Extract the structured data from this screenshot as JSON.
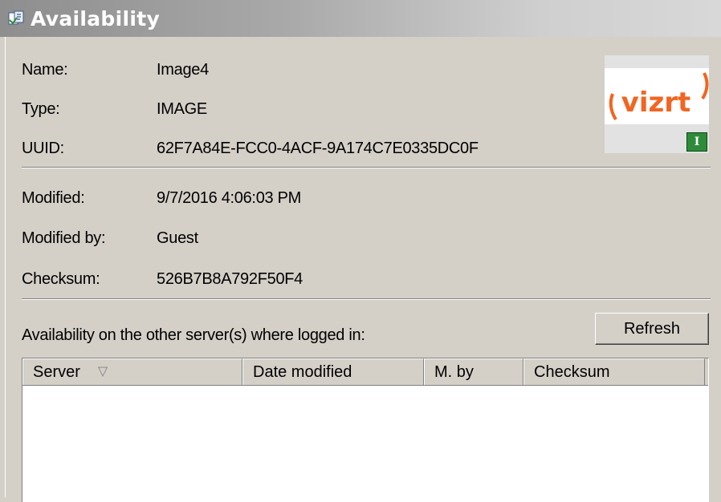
{
  "window": {
    "title": "Availability",
    "icon": "availability-icon"
  },
  "details": {
    "name_label": "Name:",
    "name_value": "Image4",
    "type_label": "Type:",
    "type_value": "IMAGE",
    "uuid_label": "UUID:",
    "uuid_value": "62F7A84E-FCC0-4ACF-9A174C7E0335DC0F",
    "modified_label": "Modified:",
    "modified_value": "9/7/2016 4:06:03 PM",
    "modified_by_label": "Modified by:",
    "modified_by_value": "Guest",
    "checksum_label": "Checksum:",
    "checksum_value": "526B7B8A792F50F4"
  },
  "thumbnail": {
    "logo_text": "vizrt",
    "badge_text": "I",
    "logo_color": "#f26522"
  },
  "availability": {
    "label": "Availability on the other server(s) where logged in:",
    "refresh_label": "Refresh",
    "columns": [
      "Server",
      "Date modified",
      "M. by",
      "Checksum"
    ],
    "sort_indicator": "▽",
    "rows": []
  },
  "colors": {
    "panel_bg": "#d4d0c8",
    "titlebar_text": "#ffffff"
  }
}
